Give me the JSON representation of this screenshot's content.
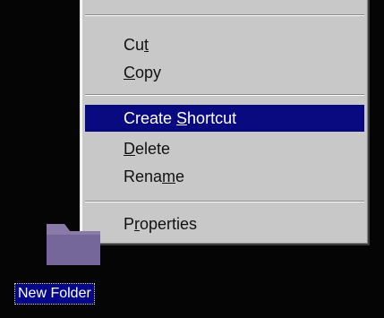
{
  "desktop": {
    "folder": {
      "label": "New Folder",
      "icon": "folder-icon"
    }
  },
  "context_menu": {
    "items": [
      {
        "id": "cut",
        "pre": "Cu",
        "accel": "t",
        "post": ""
      },
      {
        "id": "copy",
        "pre": "",
        "accel": "C",
        "post": "opy"
      },
      {
        "id": "create-shortcut",
        "pre": "Create ",
        "accel": "S",
        "post": "hortcut",
        "highlighted": true
      },
      {
        "id": "delete",
        "pre": "",
        "accel": "D",
        "post": "elete"
      },
      {
        "id": "rename",
        "pre": "Rena",
        "accel": "m",
        "post": "e"
      },
      {
        "id": "properties",
        "pre": "P",
        "accel": "r",
        "post": "operties"
      }
    ]
  },
  "colors": {
    "desktop_background": "#050505",
    "menu_background": "#c8c8c8",
    "highlight": "#0a0a80",
    "highlight_text": "#ffffff"
  }
}
